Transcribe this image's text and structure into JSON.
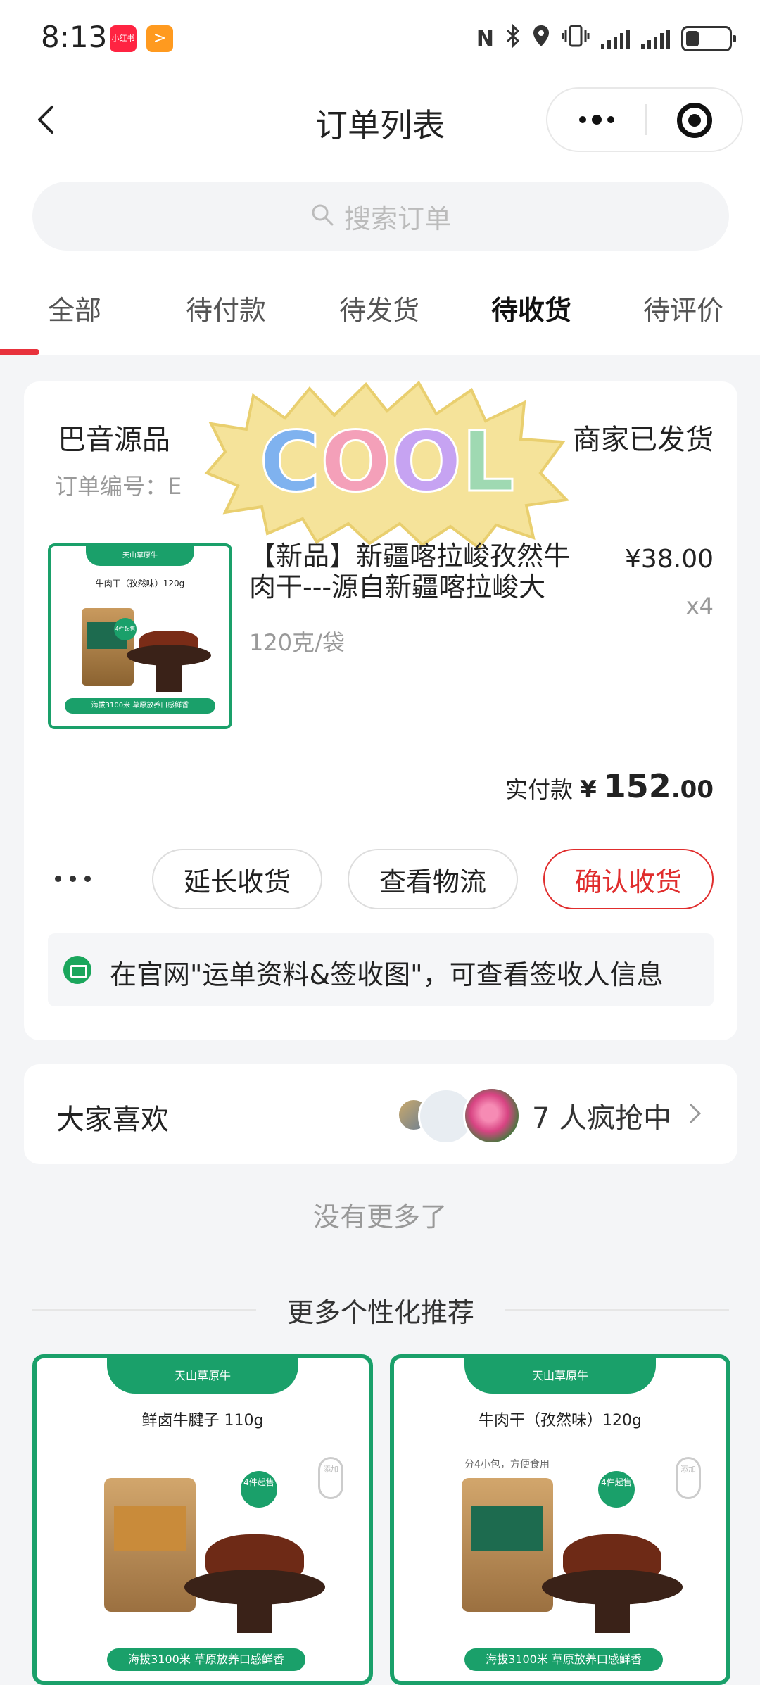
{
  "status_bar": {
    "time": "8:13",
    "app1_label": "小红书",
    "app2_label": ">",
    "nfc_label": "N"
  },
  "nav": {
    "title": "订单列表"
  },
  "search": {
    "placeholder": "搜索订单"
  },
  "tabs": [
    {
      "label": "全部",
      "active": false
    },
    {
      "label": "待付款",
      "active": false
    },
    {
      "label": "待发货",
      "active": false
    },
    {
      "label": "待收货",
      "active": true
    },
    {
      "label": "待评价",
      "active": false
    }
  ],
  "order": {
    "shop_name": "巴音源品",
    "status": "商家已发货",
    "order_no_label": "订单编号：E",
    "sticker_text": "COOL",
    "product": {
      "name": "【新品】新疆喀拉峻孜然牛肉干---源自新疆喀拉峻大",
      "price": "¥38.00",
      "qty": "x4",
      "spec": "120克/袋",
      "thumb_brand": "天山草原牛",
      "thumb_title": "牛肉干（孜然味）120g",
      "thumb_footer": "海拔3100米 草原放养口感鲜香",
      "thumb_badge": "4件起售"
    },
    "paid_label": "实付款",
    "paid_currency": "¥",
    "paid_integer": "152",
    "paid_decimal": ".00",
    "buttons": {
      "extend": "延长收货",
      "logistics": "查看物流",
      "confirm": "确认收货"
    },
    "tip": "在官网\"运单资料&签收图\"，可查看签收人信息"
  },
  "like": {
    "title": "大家喜欢",
    "count_text": "7 人疯抢中"
  },
  "no_more": "没有更多了",
  "recommend": {
    "title": "更多个性化推荐",
    "cards": [
      {
        "brand": "天山草原牛",
        "title": "鲜卤牛腱子  110g",
        "sub": "",
        "badge": "4件起售",
        "tag": "添加",
        "footer": "海拔3100米 草原放养口感鲜香"
      },
      {
        "brand": "天山草原牛",
        "title": "牛肉干（孜然味）120g",
        "sub": "分4小包，方便食用",
        "badge": "4件起售",
        "tag": "添加",
        "footer": "海拔3100米 草原放养口感鲜香"
      }
    ]
  },
  "colors": {
    "accent_red": "#e02d2d",
    "brand_green": "#1aa06a",
    "background": "#f4f5f7"
  }
}
